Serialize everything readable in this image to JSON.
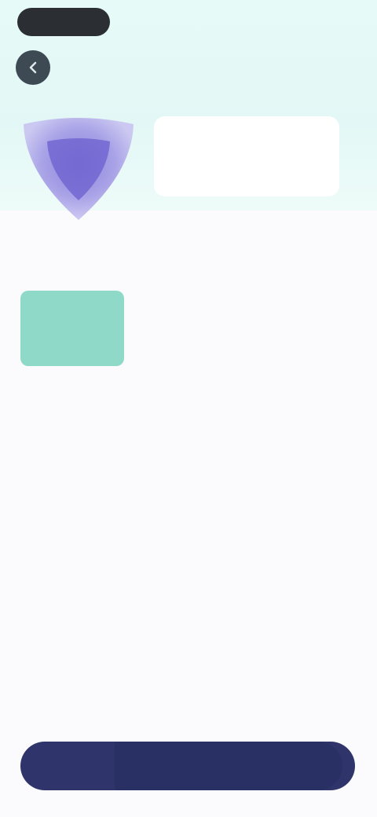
{
  "status": {
    "pill_text": ""
  },
  "nav": {
    "title": "",
    "action_label": ""
  },
  "hero": {
    "card_line1": "",
    "card_line2": "",
    "card_line3": ""
  },
  "sections": [
    {
      "label": "",
      "tiles": [
        {
          "title": "",
          "sub": "",
          "selected": true
        },
        {
          "title": "",
          "sub": "",
          "selected": false
        },
        {
          "title": "",
          "sub": "",
          "selected": false
        }
      ]
    },
    {
      "label": "",
      "tiles": [
        {
          "title": "",
          "sub": "",
          "selected": false
        },
        {
          "title": "",
          "sub": "",
          "selected": false
        },
        {
          "title": "",
          "sub": "",
          "selected": false
        }
      ]
    },
    {
      "label": "",
      "tiles": [
        {
          "title": "",
          "sub": "",
          "selected": false
        },
        {
          "title": "",
          "sub": "",
          "selected": false
        },
        {
          "title": "",
          "sub": "",
          "selected": false
        }
      ]
    }
  ],
  "footer": {
    "button_label": ""
  },
  "colors": {
    "hero_bg": "#e6faf7",
    "selected_tile": "#8fd9c9",
    "primary_button": "#2f356a"
  }
}
